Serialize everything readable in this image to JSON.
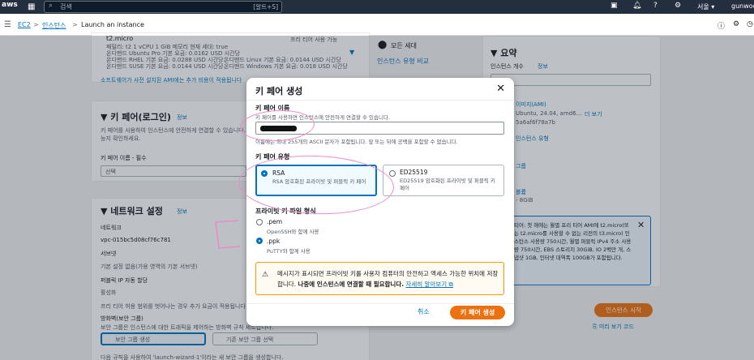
{
  "topbar": {
    "logo": "aws",
    "search_placeholder": "검색",
    "search_shortcut": "[알트+S]",
    "icons": [
      "terminal-icon",
      "bell-icon",
      "help-icon",
      "gear-icon"
    ],
    "region": "서울 ▾",
    "user": "gunwook"
  },
  "breadcrumb": {
    "items": [
      "EC2",
      "인스턴스",
      "Launch an instance"
    ],
    "separator": ">"
  },
  "background": {
    "instance_type": "t2.micro",
    "instance_specs": "패밀리: t2 1 vCPU 1 GiB 메모리 현재 세대: true",
    "price_lines": [
      "온디맨드 Ubuntu Pro 기본 요금: 0.0162 USD 시간당",
      "온디맨드 RHEL 기본 요금: 0.0288 USD 시간당",
      "온디맨드 SUSE 기본 요금: 0.0144 USD 시간당"
    ],
    "price_lines_right": [
      "온디맨드 Linux 기본 요금: 0.0144 USD 시간당",
      "온디맨드 Windows 기본 요금: 0.018 USD 시간당"
    ],
    "free_tier_label": "프리 티어 사용 가능",
    "all_generations": "모든 세대",
    "compare_types": "인스턴스 유형 비교",
    "software_note": "소프트웨어가 사전 설치된 AMI에는 추가 비용이 적용됩니다",
    "keypair_section": "키 페어(로그인)",
    "info": "정보",
    "keypair_desc": "키 페어를 사용하여 인스턴스에 안전하게 연결할 수 있습니다.",
    "keypair_desc2": "능지 확인하세요.",
    "keypair_name_label": "키 페어 이름 - 필수",
    "keypair_select": "선택",
    "network_section": "네트워크 설정",
    "network_label": "네트워크",
    "vpc": "vpc-015bc5d08cf76c781",
    "subnet_label": "서브넷",
    "subnet_value": "기본 설정 없음(가용 영역의 기본 서브넷)",
    "public_ip_label": "퍼블릭 IP 자동 할당",
    "public_ip_value": "활성화",
    "free_tier_note": "프리 티어 허용 범위를 벗어나는 경우 추가 요금이 적용됩니다",
    "firewall_label": "방화벽(보안 그룹)",
    "firewall_desc": "보안 그룹은 인스턴스에 대한 트래픽을 제어하는 방화벽 규칙 세트입니다.",
    "create_sg": "보안 그룹 생성",
    "existing_sg": "기존 보안 그룹 선택",
    "bottom_note": "다음 규칙을 사용하여 'launch-wizard-1'이라는 새 보안 그룹을 생성합니다.",
    "summary_title": "요약",
    "instance_count_label": "인스턴스 개수",
    "ami_label": "이미지(AMI)",
    "ami_value": "Ubuntu, 24.04, amd6...",
    "ami_more": "더 보기",
    "ami_id": "5a6af6f78a7b",
    "instance_type_summary": "인스턴스 유형",
    "sg_label": "그룹",
    "storage_label": "볼륨",
    "storage_value": "- 8GiB",
    "free_tier_box": "티어: 첫 해에는 월별 프리 티어 AMI에 t2.micro(또는 t2.micro를 사용할 수 없는 리전의 t3.micro) 인스턴스 사용량 750시간, 월별 퍼블릭 IPv4 주소 사용량 750시간, EBS 스토리지 30GiB, IO 2백만 개, 스냅샷 1GB, 인터넷 대역폭 100GB가 포함됩니다.",
    "launch_button": "인스턴스 시작",
    "preview_code": "미리 보기 코드"
  },
  "modal": {
    "title": "키 페어 생성",
    "name_label": "키 페어 이름",
    "name_desc": "키 페어를 사용하면 인스턴스에 안전하게 연결할 수 있습니다.",
    "name_hint": "이름에는 최대 255개의 ASCII 문자가 포함됩니다. 앞 또는 뒤에 공백을 포함할 수 없습니다.",
    "type_label": "키 페어 유형",
    "types": [
      {
        "title": "RSA",
        "desc": "RSA 암호화된 프라이빗 및 퍼블릭 키 페어",
        "selected": true
      },
      {
        "title": "ED25519",
        "desc": "ED25519 암호화된 프라이빗 및 퍼블릭 키 페어",
        "selected": false
      }
    ],
    "format_label": "프라이빗 키 파일 형식",
    "formats": [
      {
        "title": ".pem",
        "desc": "OpenSSH와 함께 사용",
        "selected": false
      },
      {
        "title": ".ppk",
        "desc": "PuTTY와 함께 사용",
        "selected": true
      }
    ],
    "warning": "메시지가 표시되면 프라이빗 키를 사용자 컴퓨터의 안전하고 액세스 가능한 위치에 저장합니다.",
    "warning_bold": "나중에 인스턴스에 연결할 때 필요합니다.",
    "warning_link": "자세히 알아보기",
    "cancel": "취소",
    "create": "키 페어 생성"
  }
}
